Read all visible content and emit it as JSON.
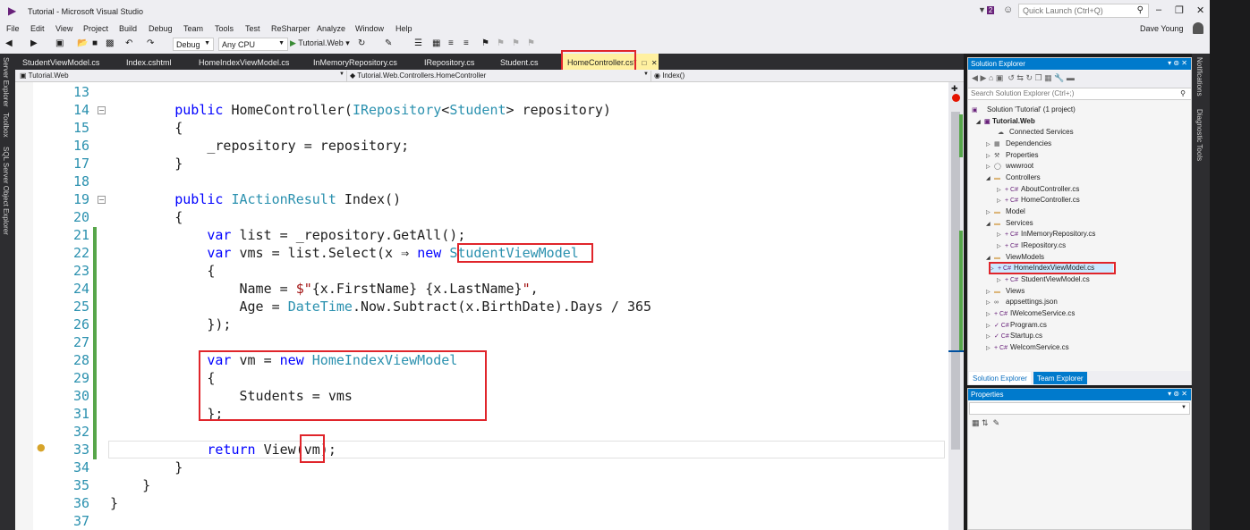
{
  "window": {
    "title": "Tutorial - Microsoft Visual Studio",
    "notification_count": "2",
    "quick_launch_placeholder": "Quick Launch (Ctrl+Q)",
    "user": "Dave Young"
  },
  "menu": [
    "File",
    "Edit",
    "View",
    "Project",
    "Build",
    "Debug",
    "Team",
    "Tools",
    "Test",
    "ReSharper",
    "Analyze",
    "Window",
    "Help"
  ],
  "toolbar": {
    "configuration": "Debug",
    "platform": "Any CPU",
    "run_target": "Tutorial.Web"
  },
  "left_strip": [
    "Server Explorer",
    "Toolbox",
    "SQL Server Object Explorer"
  ],
  "right_strip": [
    "Notifications",
    "Diagnostic Tools"
  ],
  "tabs": [
    {
      "label": "StudentViewModel.cs"
    },
    {
      "label": "Index.cshtml"
    },
    {
      "label": "HomeIndexViewModel.cs"
    },
    {
      "label": "InMemoryRepository.cs"
    },
    {
      "label": "IRepository.cs"
    },
    {
      "label": "Student.cs"
    },
    {
      "label": "HomeController.cs*",
      "active": true
    }
  ],
  "navbar": {
    "project": "Tutorial.Web",
    "class": "Tutorial.Web.Controllers.HomeController",
    "member": "Index()"
  },
  "code_lines": [
    {
      "n": "13",
      "text": ""
    },
    {
      "n": "14",
      "text": "        public HomeController(IRepository<Student> repository)"
    },
    {
      "n": "15",
      "text": "        {"
    },
    {
      "n": "16",
      "text": "            _repository = repository;"
    },
    {
      "n": "17",
      "text": "        }"
    },
    {
      "n": "18",
      "text": ""
    },
    {
      "n": "19",
      "text": "        public IActionResult Index()"
    },
    {
      "n": "20",
      "text": "        {"
    },
    {
      "n": "21",
      "text": "            var list = _repository.GetAll();"
    },
    {
      "n": "22",
      "text": "            var vms = list.Select(x ⇒ new StudentViewModel"
    },
    {
      "n": "23",
      "text": "            {"
    },
    {
      "n": "24",
      "text": "                Name = $\"{x.FirstName} {x.LastName}\","
    },
    {
      "n": "25",
      "text": "                Age = DateTime.Now.Subtract(x.BirthDate).Days / 365"
    },
    {
      "n": "26",
      "text": "            });"
    },
    {
      "n": "27",
      "text": ""
    },
    {
      "n": "28",
      "text": "            var vm = new HomeIndexViewModel"
    },
    {
      "n": "29",
      "text": "            {"
    },
    {
      "n": "30",
      "text": "                Students = vms"
    },
    {
      "n": "31",
      "text": "            };"
    },
    {
      "n": "32",
      "text": ""
    },
    {
      "n": "33",
      "text": "            return View(vm);"
    },
    {
      "n": "34",
      "text": "        }"
    },
    {
      "n": "35",
      "text": "    }"
    },
    {
      "n": "36",
      "text": "}"
    },
    {
      "n": "37",
      "text": ""
    }
  ],
  "solution_explorer": {
    "title": "Solution Explorer",
    "search_placeholder": "Search Solution Explorer (Ctrl+;)",
    "items": [
      {
        "label": "Solution 'Tutorial' (1 project)"
      },
      {
        "label": "Tutorial.Web"
      },
      {
        "label": "Connected Services"
      },
      {
        "label": "Dependencies"
      },
      {
        "label": "Properties"
      },
      {
        "label": "wwwroot"
      },
      {
        "label": "Controllers"
      },
      {
        "label": "AboutController.cs"
      },
      {
        "label": "HomeController.cs"
      },
      {
        "label": "Model"
      },
      {
        "label": "Services"
      },
      {
        "label": "InMemoryRepository.cs"
      },
      {
        "label": "IRepository.cs"
      },
      {
        "label": "ViewModels"
      },
      {
        "label": "HomeIndexViewModel.cs"
      },
      {
        "label": "StudentViewModel.cs"
      },
      {
        "label": "Views"
      },
      {
        "label": "appsettings.json"
      },
      {
        "label": "IWelcomeService.cs"
      },
      {
        "label": "Program.cs"
      },
      {
        "label": "Startup.cs"
      },
      {
        "label": "WelcomService.cs"
      }
    ],
    "tabs": [
      "Solution Explorer",
      "Team Explorer"
    ]
  },
  "properties": {
    "title": "Properties"
  }
}
